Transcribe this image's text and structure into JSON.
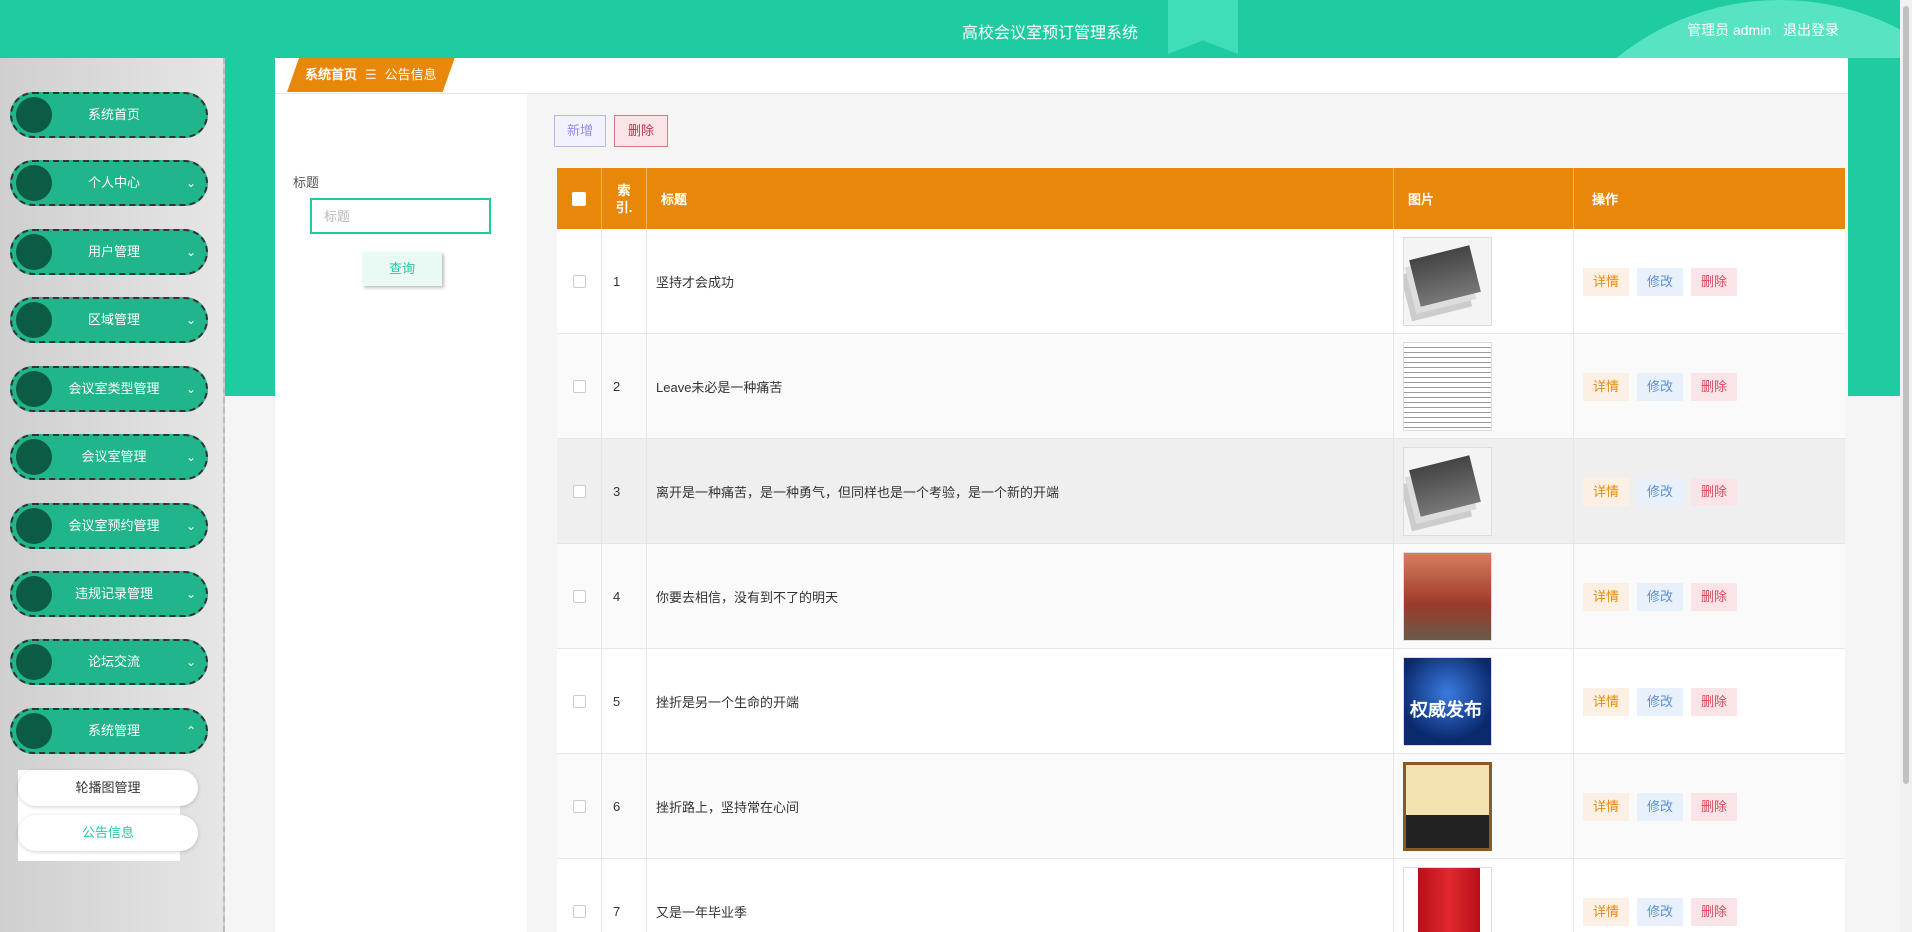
{
  "header": {
    "title": "高校会议室预订管理系统",
    "user_label": "管理员 admin",
    "logout_label": "退出登录"
  },
  "sidebar": {
    "items": [
      {
        "label": "系统首页",
        "chevron": ""
      },
      {
        "label": "个人中心",
        "chevron": "⌄"
      },
      {
        "label": "用户管理",
        "chevron": "⌄"
      },
      {
        "label": "区域管理",
        "chevron": "⌄"
      },
      {
        "label": "会议室类型管理",
        "chevron": "⌄"
      },
      {
        "label": "会议室管理",
        "chevron": "⌄"
      },
      {
        "label": "会议室预约管理",
        "chevron": "⌄"
      },
      {
        "label": "违规记录管理",
        "chevron": "⌄"
      },
      {
        "label": "论坛交流",
        "chevron": "⌄"
      },
      {
        "label": "系统管理",
        "chevron": "⌃"
      }
    ],
    "submenu": [
      {
        "label": "轮播图管理"
      },
      {
        "label": "公告信息"
      }
    ]
  },
  "breadcrumb": {
    "home": "系统首页",
    "separator": "☰",
    "current": "公告信息"
  },
  "search": {
    "label": "标题",
    "placeholder": "标题",
    "query_label": "查询"
  },
  "toolbar": {
    "add_label": "新增",
    "delete_label": "删除"
  },
  "table": {
    "headers": {
      "index": "索\n引.",
      "title": "标题",
      "picture": "图片",
      "operation": "操作"
    },
    "actions": {
      "detail": "详情",
      "edit": "修改",
      "delete": "删除"
    },
    "rows": [
      {
        "index": "1",
        "title": "坚持才会成功",
        "thumb": "news"
      },
      {
        "index": "2",
        "title": "Leave未必是一种痛苦",
        "thumb": "doc"
      },
      {
        "index": "3",
        "title": "离开是一种痛苦，是一种勇气，但同样也是一个考验，是一个新的开端",
        "thumb": "news"
      },
      {
        "index": "4",
        "title": "你要去相信，没有到不了的明天",
        "thumb": "arch"
      },
      {
        "index": "5",
        "title": "挫折是另一个生命的开端",
        "thumb": "blue",
        "thumb_text": "权威发布"
      },
      {
        "index": "6",
        "title": "挫折路上，坚持常在心间",
        "thumb": "cartoon"
      },
      {
        "index": "7",
        "title": "又是一年毕业季",
        "thumb": "book"
      }
    ]
  },
  "colors": {
    "primary": "#1fcba0",
    "accent": "#e8880a",
    "danger": "#d64a5e"
  }
}
